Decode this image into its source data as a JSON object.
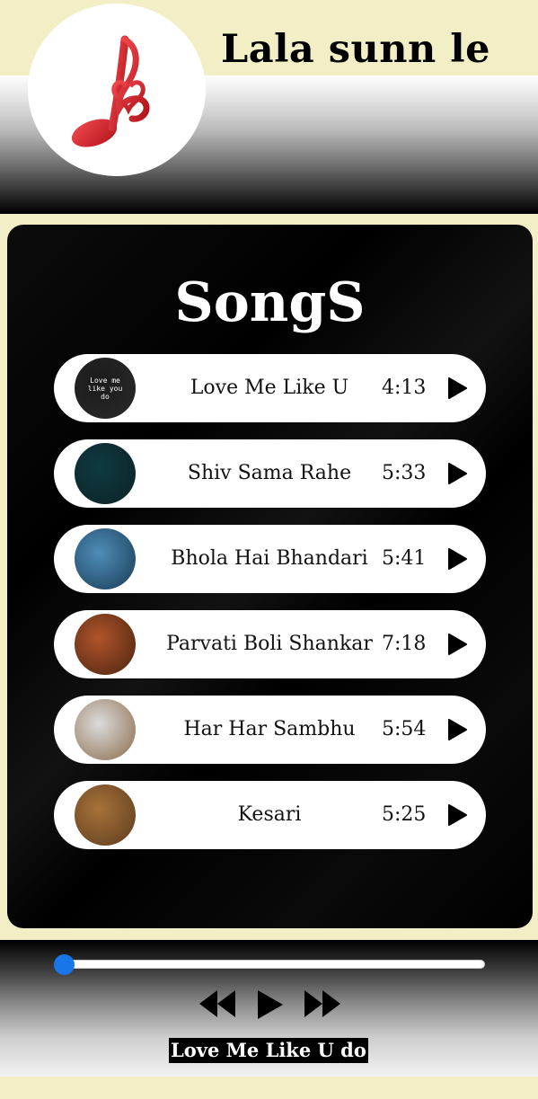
{
  "header": {
    "title": "Lala sunn le",
    "logo_icon": "music-note-icon",
    "colors": {
      "background": "#f2efc6",
      "logo_note": "#d81f26"
    }
  },
  "songs_panel": {
    "title": "SongS",
    "items": [
      {
        "title": "Love Me Like U",
        "duration": "4:13",
        "thumb_text": "Love me like you do",
        "thumb_colors": [
          "#1a1a1a",
          "#2b2b2b"
        ]
      },
      {
        "title": "Shiv Sama Rahe",
        "duration": "5:33",
        "thumb_text": "",
        "thumb_colors": [
          "#0f3a40",
          "#0b2226"
        ]
      },
      {
        "title": "Bhola Hai Bhandari",
        "duration": "5:41",
        "thumb_text": "",
        "thumb_colors": [
          "#4f8db8",
          "#193b55"
        ]
      },
      {
        "title": "Parvati Boli Shankar",
        "duration": "7:18",
        "thumb_text": "",
        "thumb_colors": [
          "#b0542a",
          "#4a2410"
        ]
      },
      {
        "title": "Har Har Sambhu",
        "duration": "5:54",
        "thumb_text": "",
        "thumb_colors": [
          "#dcdcdc",
          "#8a6a4a"
        ]
      },
      {
        "title": "Kesari",
        "duration": "5:25",
        "thumb_text": "",
        "thumb_colors": [
          "#a7723a",
          "#5c3b1d"
        ]
      }
    ],
    "play_icon": "play-icon"
  },
  "player": {
    "progress": 0.0,
    "accent_color": "#1976e8",
    "prev_icon": "rewind-icon",
    "play_icon": "play-icon",
    "next_icon": "fast-forward-icon",
    "now_playing": "Love Me Like U do"
  }
}
